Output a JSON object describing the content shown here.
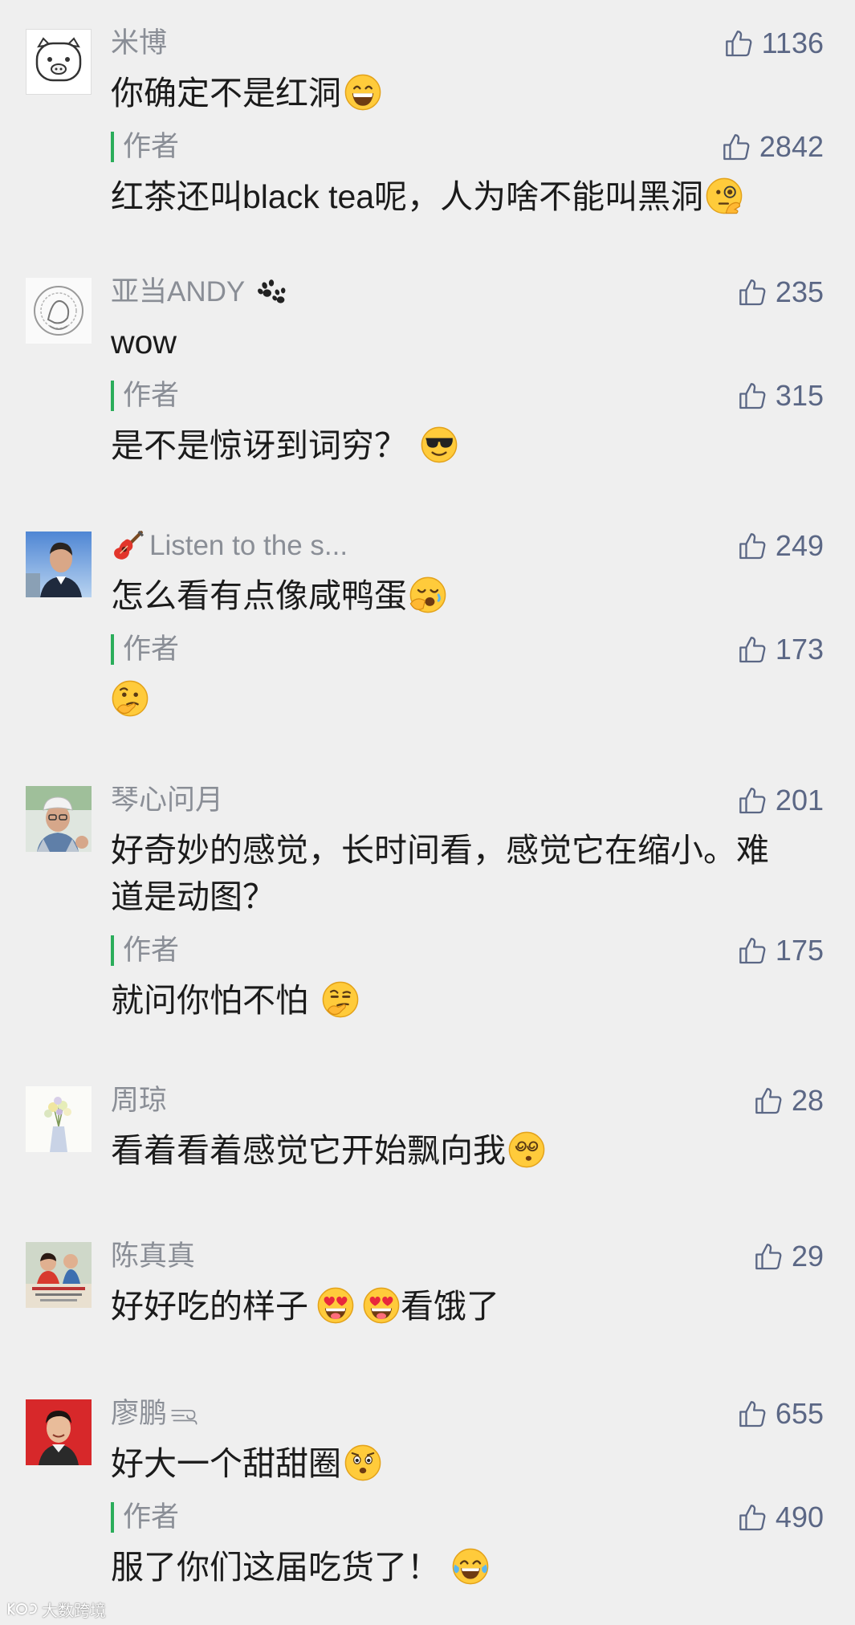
{
  "comments": [
    {
      "user": "米博",
      "likes": "1136",
      "text": "你确定不是红洞",
      "text_emoji": "grinning-face",
      "reply": {
        "label": "作者",
        "likes": "2842",
        "text": "红茶还叫black tea呢，人为啥不能叫黑洞",
        "emoji": "face-with-monocle"
      }
    },
    {
      "user": "亚当ANDY",
      "user_icon": "paw-prints",
      "likes": "235",
      "text": "wow",
      "reply": {
        "label": "作者",
        "likes": "315",
        "text": "是不是惊讶到词穷？",
        "emoji": "smiling-face-with-sunglasses"
      }
    },
    {
      "user": "Listen to the s...",
      "user_icon": "guitar",
      "likes": "249",
      "text": "怎么看有点像咸鸭蛋",
      "text_emoji": "yawning-face",
      "reply": {
        "label": "作者",
        "likes": "173",
        "emoji": "thinking-face"
      }
    },
    {
      "user": "琴心问月",
      "likes": "201",
      "text_lines": [
        "好奇妙的感觉，长时间看，感觉它在缩小。难",
        "道是动图？"
      ],
      "reply": {
        "label": "作者",
        "likes": "175",
        "text": "就问你怕不怕",
        "emoji": "smirking-thinking-face"
      }
    },
    {
      "user": "周琼",
      "likes": "28",
      "text": "看着看着感觉它开始飘向我",
      "text_emoji": "dizzy-face"
    },
    {
      "user": "陈真真",
      "likes": "29",
      "text": "好好吃的样子",
      "text_emoji": "heart-eyes-tongue-face",
      "text_after": "看饿了"
    },
    {
      "user": "廖鹏",
      "user_icon": "wind-swirl",
      "likes": "655",
      "text": "好大一个甜甜圈",
      "text_emoji": "astonished-face",
      "reply": {
        "label": "作者",
        "likes": "490",
        "text": "服了你们这届吃货了！",
        "emoji": "face-with-tears-of-joy"
      }
    }
  ],
  "watermark": "大数跨境",
  "colors": {
    "background": "#efefef",
    "author_accent": "#2bad5b",
    "like": "#5b6785",
    "name": "#8a8e96",
    "text": "#1b1b1b"
  }
}
